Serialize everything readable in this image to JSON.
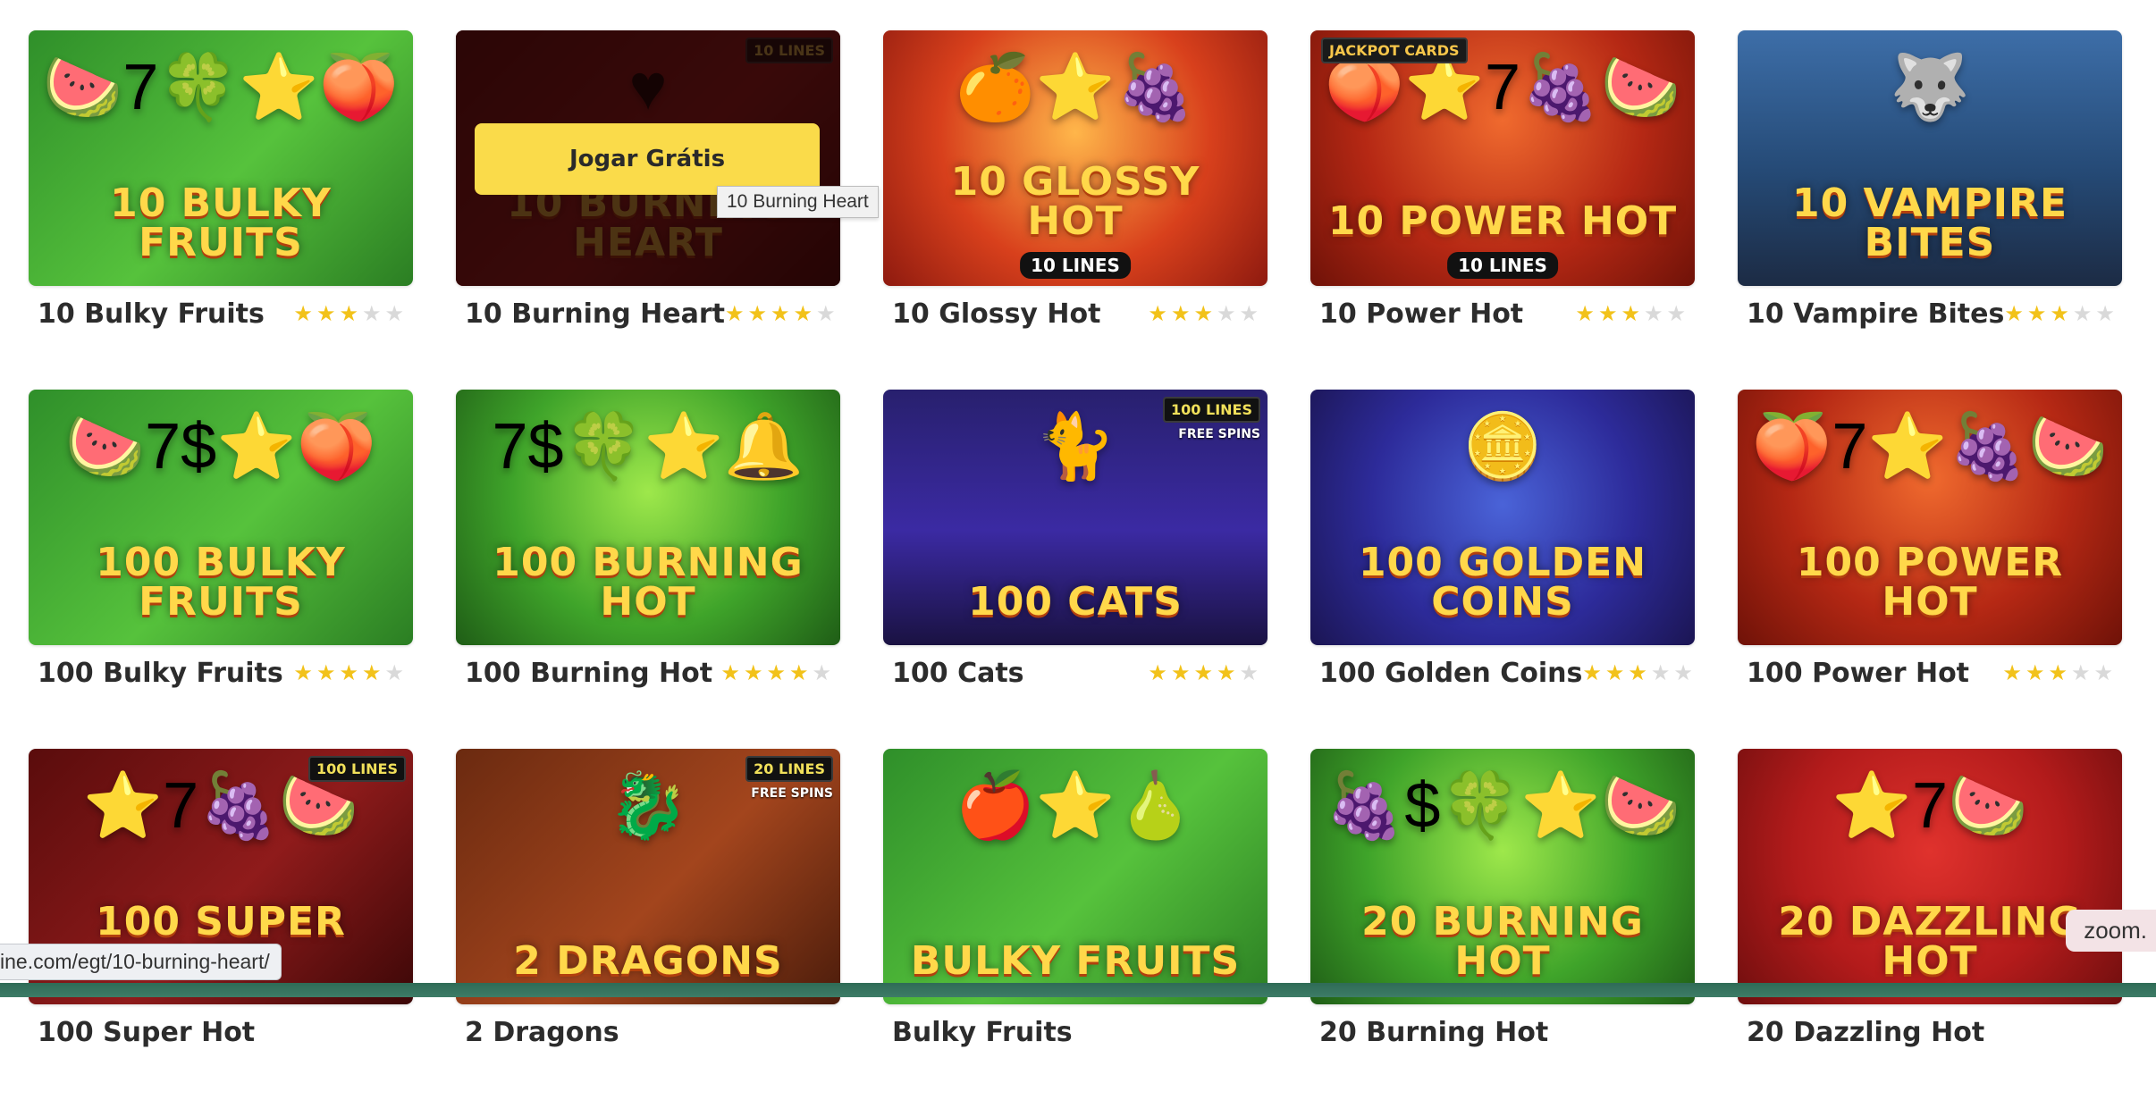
{
  "tooltip": "10 Burning Heart",
  "status_url": "ine.com/egt/10-burning-heart/",
  "zoom_label": "zoom.",
  "play_label": "Jogar Grátis",
  "games": [
    {
      "name": "10 Bulky Fruits",
      "rating": 3,
      "art_title": "10 Bulky Fruits",
      "icons": "🍉7🍀⭐🍑",
      "bg": "linear-gradient(135deg,#2f8f2a,#56c23c 55%,#2b7e23)"
    },
    {
      "name": "10 Burning Heart",
      "rating": 4,
      "art_title": "10 Burning Heart",
      "icons": "♥",
      "bg": "linear-gradient(135deg,#6a0d0d,#a91f1f 55%,#4d0808)",
      "badge": "10 LINES",
      "hover": true
    },
    {
      "name": "10 Glossy Hot",
      "rating": 3,
      "art_title": "10 Glossy Hot",
      "icons": "🍊⭐🍇",
      "bg": "radial-gradient(circle at 50% 40%,#ffb64a,#d8401c 55%,#8e1a0f)",
      "sub_art": "10 LINES"
    },
    {
      "name": "10 Power Hot",
      "rating": 3,
      "art_title": "10 Power Hot",
      "icons": "🍑⭐7🍇🍉",
      "bg": "radial-gradient(circle at 50% 35%,#f06a2e,#b52814 55%,#6f1208)",
      "badge_left": "JACKPOT CARDS",
      "sub_art": "10 LINES"
    },
    {
      "name": "10 Vampire Bites",
      "rating": 3,
      "art_title": "10 Vampire Bites",
      "icons": "🐺",
      "bg": "linear-gradient(180deg,#3d6ea8,#254a76 55%,#1c2b44)"
    },
    {
      "name": "100 Bulky Fruits",
      "rating": 4,
      "art_title": "100 Bulky Fruits",
      "icons": "🍉7$⭐🍑",
      "bg": "linear-gradient(135deg,#2f8f2a,#56c23c 55%,#2b7e23)"
    },
    {
      "name": "100 Burning Hot",
      "rating": 4,
      "art_title": "100 Burning Hot",
      "icons": "7$🍀⭐🔔",
      "bg": "radial-gradient(circle at 50% 40%,#9ee84b,#3fa42a 55%,#1f5d16)"
    },
    {
      "name": "100 Cats",
      "rating": 4,
      "art_title": "100 Cats",
      "icons": "🐈",
      "bg": "linear-gradient(180deg,#28206e,#3b2aa3 55%,#1a1242)",
      "badge": "100 LINES",
      "sub_badge": "FREE SPINS"
    },
    {
      "name": "100 Golden Coins",
      "rating": 3,
      "art_title": "100 Golden Coins",
      "icons": "🪙",
      "bg": "radial-gradient(circle at 50% 45%,#4a63d8,#2d2b9a 55%,#1b1553)"
    },
    {
      "name": "100 Power Hot",
      "rating": 3,
      "art_title": "100 Power Hot",
      "icons": "🍑7⭐🍇🍉",
      "bg": "radial-gradient(circle at 50% 35%,#f06a2e,#b52814 55%,#6f1208)"
    },
    {
      "name": "100 Super Hot",
      "rating": 0,
      "art_title": "100 Super Hot",
      "icons": "⭐7🍇🍉",
      "bg": "linear-gradient(135deg,#5a0c0c,#8f1b1b 55%,#3c0707)",
      "badge": "100 LINES"
    },
    {
      "name": "2 Dragons",
      "rating": 0,
      "art_title": "2 Dragons",
      "icons": "🐉",
      "bg": "linear-gradient(135deg,#6b2a10,#a3451d 55%,#4b1c0b)",
      "badge": "20 LINES",
      "sub_badge": "FREE SPINS"
    },
    {
      "name": "Bulky Fruits",
      "rating": 0,
      "art_title": "Bulky Fruits",
      "icons": "🍎⭐🍐",
      "bg": "linear-gradient(135deg,#2f8f2a,#56c23c 55%,#2b7e23)"
    },
    {
      "name": "20 Burning Hot",
      "rating": 0,
      "art_title": "20 Burning Hot",
      "icons": "🍇$🍀⭐🍉",
      "bg": "radial-gradient(circle at 50% 40%,#9ee84b,#3fa42a 55%,#1f5d16)"
    },
    {
      "name": "20 Dazzling Hot",
      "rating": 0,
      "art_title": "20 Dazzling Hot",
      "icons": "⭐7🍉",
      "bg": "radial-gradient(circle at 50% 40%,#e0322d,#b31b1b 55%,#6e0e0e)"
    }
  ]
}
